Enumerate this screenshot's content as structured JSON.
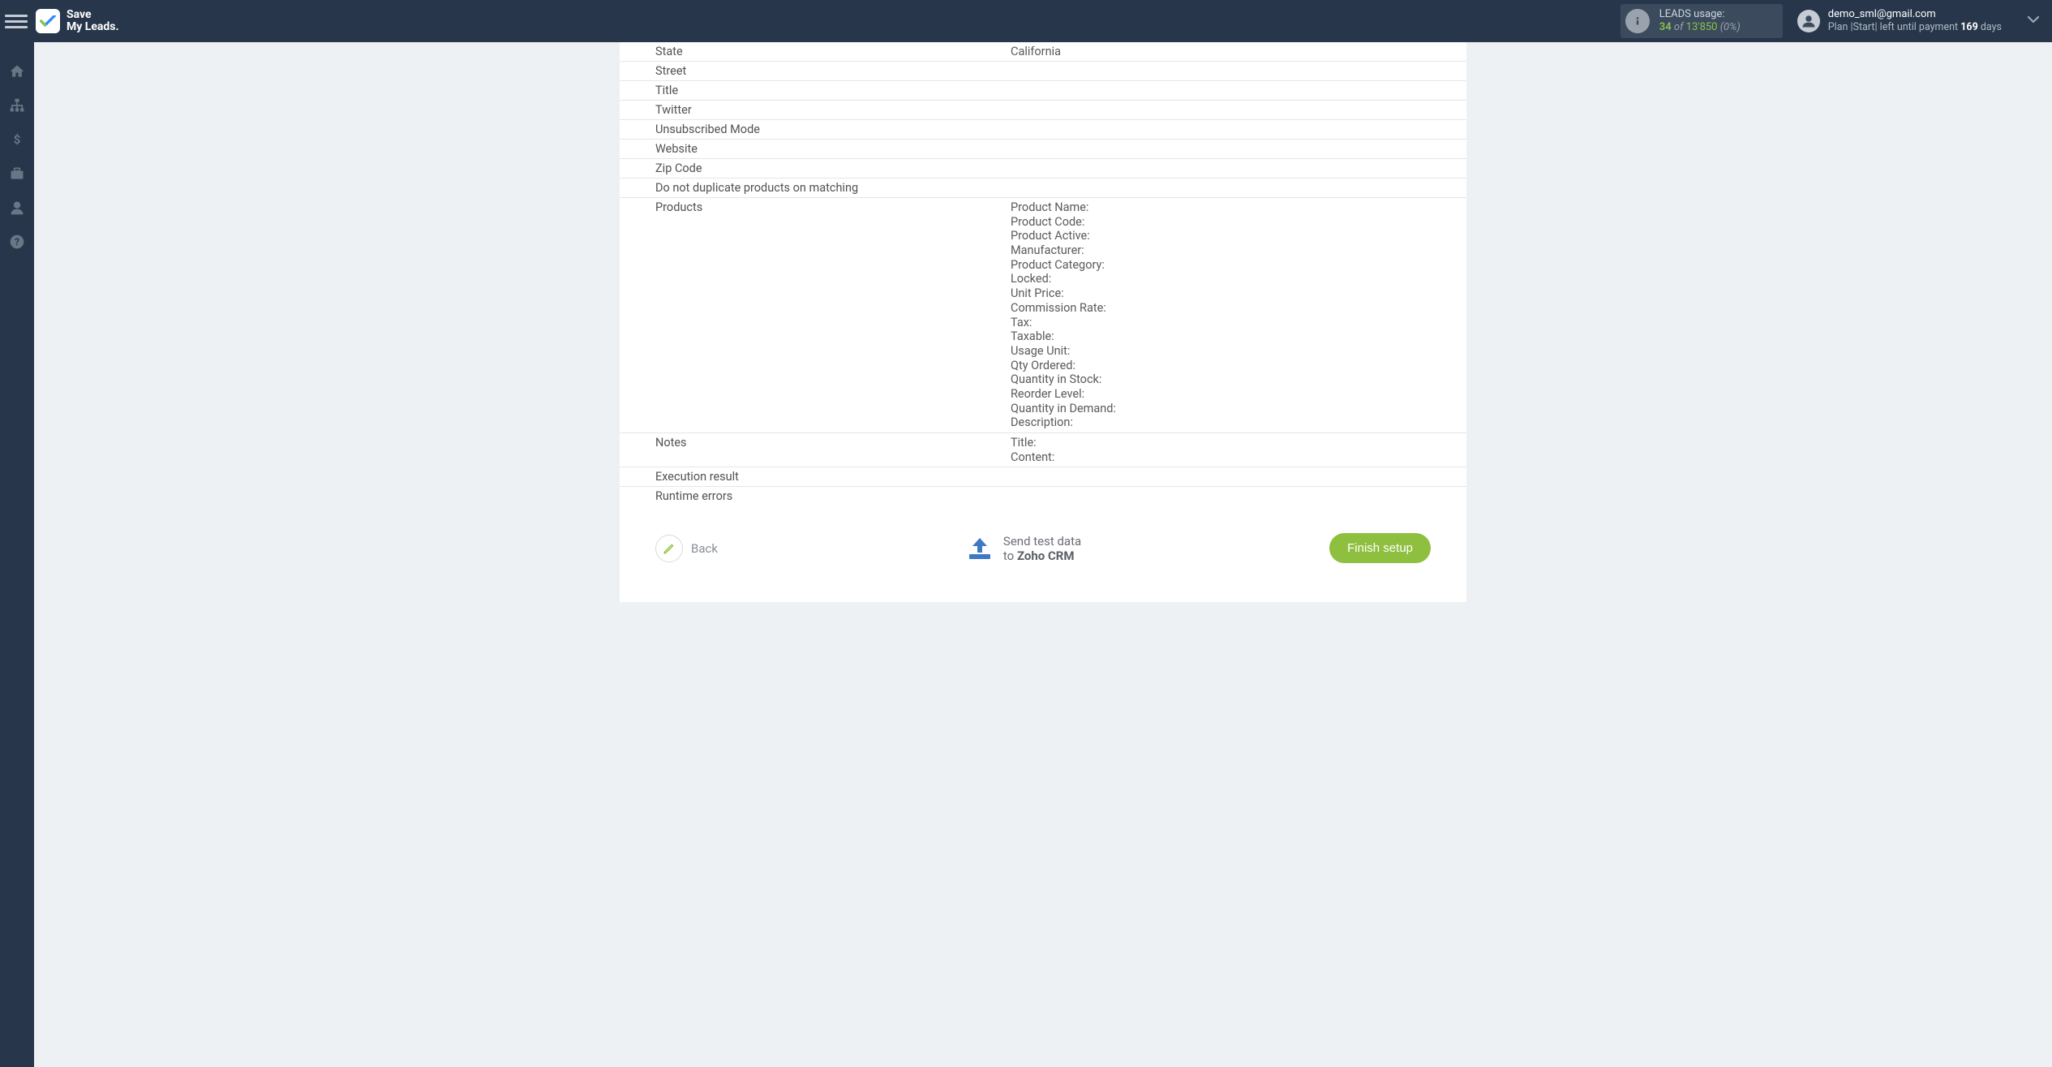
{
  "brand": {
    "line1": "Save",
    "line2": "My Leads."
  },
  "usage": {
    "label": "LEADS usage:",
    "used": "34",
    "of": "of",
    "total": "13'850",
    "pct": "(0%)"
  },
  "user": {
    "email": "demo_sml@gmail.com",
    "plan_prefix": "Plan |Start| left until payment ",
    "plan_days": "169",
    "plan_suffix": " days"
  },
  "rows": [
    {
      "label": "State",
      "value": "California"
    },
    {
      "label": "Street",
      "value": ""
    },
    {
      "label": "Title",
      "value": ""
    },
    {
      "label": "Twitter",
      "value": ""
    },
    {
      "label": "Unsubscribed Mode",
      "value": ""
    },
    {
      "label": "Website",
      "value": ""
    },
    {
      "label": "Zip Code",
      "value": ""
    },
    {
      "label": "Do not duplicate products on matching",
      "value": ""
    }
  ],
  "products": {
    "label": "Products",
    "lines": [
      "Product Name:",
      "Product Code:",
      "Product Active:",
      "Manufacturer:",
      "Product Category:",
      "Locked:",
      "Unit Price:",
      "Commission Rate:",
      "Tax:",
      "Taxable:",
      "Usage Unit:",
      "Qty Ordered:",
      "Quantity in Stock:",
      "Reorder Level:",
      "Quantity in Demand:",
      "Description:"
    ]
  },
  "notes": {
    "label": "Notes",
    "lines": [
      "Title:",
      "Content:"
    ]
  },
  "tail_rows": [
    {
      "label": "Execution result",
      "value": ""
    },
    {
      "label": "Runtime errors",
      "value": ""
    }
  ],
  "actions": {
    "back": "Back",
    "send_line1": "Send test data",
    "send_line2_prefix": "to ",
    "send_line2_crm": "Zoho CRM",
    "finish": "Finish setup"
  }
}
